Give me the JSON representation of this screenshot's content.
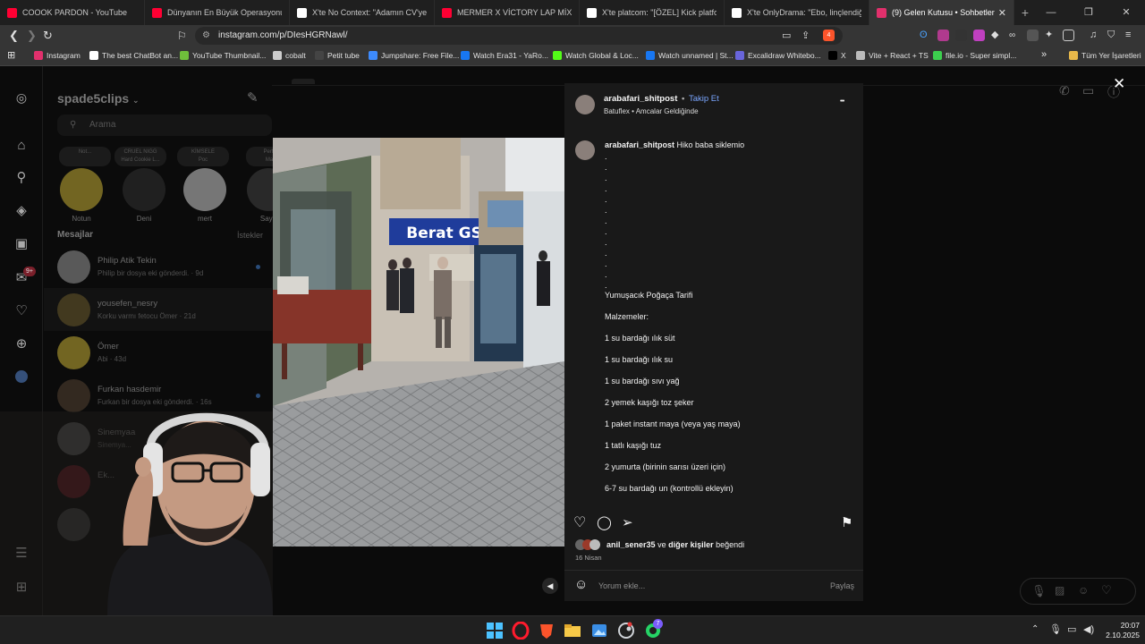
{
  "browser": {
    "tabs": [
      {
        "title": "COOOK PARDON - YouTube",
        "color": "#ff0033"
      },
      {
        "title": "Dünyanın En Büyük Operasyonu: Us",
        "color": "#ff0033"
      },
      {
        "title": "X'te No Context: \"Adamın CV'ye bak",
        "color": "#ffffff"
      },
      {
        "title": "MERMER X VİCTORY LAP MİX (PROC",
        "color": "#ff0033"
      },
      {
        "title": "X'te platcom: \"[ÖZEL] Kick platform",
        "color": "#ffffff"
      },
      {
        "title": "X'te OnlyDrama: \"Ebo, linçlendiği kı",
        "color": "#ffffff"
      },
      {
        "title": "(9) Gelen Kutusu • Sohbetler",
        "color": "#e1306c",
        "active": true
      }
    ],
    "new_tab": "+",
    "url": "instagram.com/p/DIesHGRNawl/",
    "shield_badge": "4",
    "bookmarks": [
      {
        "label": "Instagram",
        "color": "#e1306c"
      },
      {
        "label": "The best ChatBot an...",
        "color": "#ffffff"
      },
      {
        "label": "YouTube Thumbnail...",
        "color": "#6fbf3b"
      },
      {
        "label": "cobalt",
        "color": "#cccccc"
      },
      {
        "label": "Petit tube",
        "color": "#444444"
      },
      {
        "label": "Jumpshare: Free File...",
        "color": "#3d8bfd"
      },
      {
        "label": "Watch Era31 - YaRo...",
        "color": "#1877f2"
      },
      {
        "label": "Watch Global & Loc...",
        "color": "#53fc18"
      },
      {
        "label": "Watch unnamed | St...",
        "color": "#1877f2"
      },
      {
        "label": "Excalidraw Whitebo...",
        "color": "#6965db"
      },
      {
        "label": "X",
        "color": "#000000"
      },
      {
        "label": "Vite + React + TS",
        "color": "#bbbbbb"
      },
      {
        "label": "file.io - Super simpl...",
        "color": "#3ccf4e"
      }
    ],
    "more_bookmarks": "»",
    "all_bookmarks": "Tüm Yer İşaretleri"
  },
  "instagram": {
    "account_name": "spade5clips",
    "search_placeholder": "Arama",
    "notes": [
      {
        "text": "Not..."
      },
      {
        "text": "CRUEL NIGG\nHard Cookie L..."
      },
      {
        "text": "KİMSELE\nPoc"
      },
      {
        "text": "Perfect\nMaks"
      }
    ],
    "stories": [
      {
        "name": "Notun",
        "color": "#c9b037"
      },
      {
        "name": "Deni",
        "color": "#333333"
      },
      {
        "name": "mert",
        "color": "#cfcfcf"
      },
      {
        "name": "Saye",
        "color": "#444444"
      }
    ],
    "messages_label": "Mesajlar",
    "requests_label": "İstekler",
    "notif_badge": "9+",
    "conversations": [
      {
        "name": "Philip Atik Tekin",
        "snippet": "Philip bir dosya eki gönderdi. · 9d",
        "unread": true,
        "color": "#9a9a9a"
      },
      {
        "name": "yousefen_nesry",
        "snippet": "Korku varmı fetocu Ömer · 21d",
        "unread": false,
        "color": "#6a5a2a"
      },
      {
        "name": "Ömer",
        "snippet": "Abi · 43d",
        "unread": false,
        "color": "#c9b037"
      },
      {
        "name": "Furkan hasdemir",
        "snippet": "Furkan bir dosya eki gönderdi. · 16s",
        "unread": true,
        "color": "#554433"
      },
      {
        "name": "Sinemyaa",
        "snippet": "Sinemya...",
        "unread": false,
        "color": "#777777"
      },
      {
        "name": "Ek...",
        "snippet": "",
        "unread": false,
        "color": "#8a1e2a"
      },
      {
        "name": "",
        "snippet": "",
        "unread": false,
        "color": "#555555"
      }
    ]
  },
  "video": {
    "shop_sign": "Berat GSM",
    "shop_sign_2": "Berat GSM"
  },
  "post": {
    "username": "arabafari_shitpost",
    "separator": "•",
    "follow": "Takip Et",
    "audio": "Batuflex • Amcalar Geldiğinde",
    "more": "•••",
    "caption_user": "arabafari_shitpost",
    "caption_first": "Hiko baba siklemio",
    "dots": [
      ".",
      ".",
      ".",
      ".",
      ".",
      ".",
      ".",
      ".",
      ".",
      ".",
      ".",
      ".",
      "."
    ],
    "recipe_title": "Yumuşacık Poğaça Tarifi",
    "materials_label": "Malzemeler:",
    "ingredients": [
      "1 su bardağı ılık süt",
      "1 su bardağı ılık su",
      "1 su bardağı sıvı yağ",
      "2 yemek kaşığı toz şeker",
      "1 paket instant maya (veya yaş maya)",
      "1 tatlı kaşığı tuz",
      "2 yumurta (birinin sarısı üzeri için)",
      "6-7 su bardağı un (kontrollü ekleyin)"
    ],
    "liked_by_user": "anil_sener35",
    "liked_and": "ve",
    "liked_others": "diğer kişiler",
    "liked_suffix": "beğendi",
    "date": "16 Nisan",
    "comment_placeholder": "Yorum ekle...",
    "share": "Paylaş"
  },
  "close_glyph": "✕",
  "taskbar": {
    "time": "20:07",
    "date": "2.10.2025",
    "whatsapp_badge": "7"
  }
}
